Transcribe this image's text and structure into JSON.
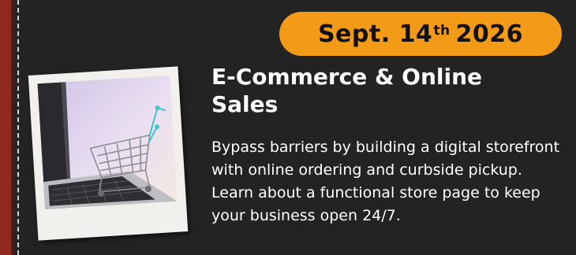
{
  "card": {
    "date": {
      "prefix": "Sept. 14",
      "suffix": "th",
      "year": "2026"
    },
    "title": "E-Commerce & Online Sales",
    "description": "Bypass barriers by building a digital storefront with online ordering and curbside pickup. Learn about a functional store page to keep your business open 24/7.",
    "photo_icon": "shopping-cart-on-laptop-icon",
    "colors": {
      "background": "#232323",
      "accent": "#f39a17",
      "left_edge": "#8e2a1c",
      "text": "#ffffff"
    }
  }
}
